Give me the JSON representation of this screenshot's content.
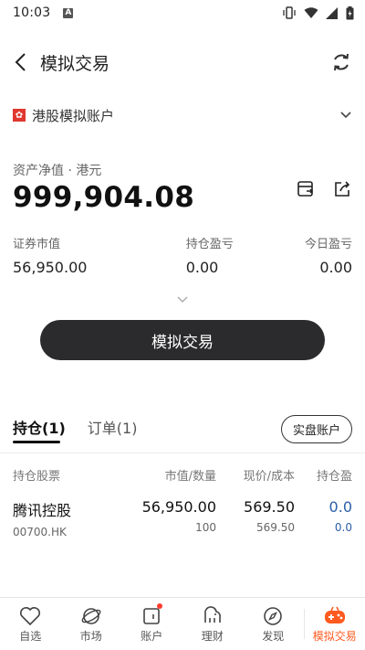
{
  "status_bar": {
    "time": "10:03",
    "badge": "A"
  },
  "nav": {
    "title": "模拟交易"
  },
  "account": {
    "name": "港股模拟账户",
    "flag": "✿"
  },
  "asset": {
    "label": "资产净值 · 港元",
    "value": "999,904.08"
  },
  "stats": [
    {
      "label": "证券市值",
      "value": "56,950.00"
    },
    {
      "label": "持仓盈亏",
      "value": "0.00"
    },
    {
      "label": "今日盈亏",
      "value": "0.00"
    }
  ],
  "trade_button": "模拟交易",
  "tabs": [
    {
      "label": "持仓(1)"
    },
    {
      "label": "订单(1)"
    }
  ],
  "real_account_button": "实盘账户",
  "table": {
    "headers": [
      "持仓股票",
      "市值/数量",
      "现价/成本",
      "持仓盈"
    ],
    "rows": [
      {
        "name": "腾讯控股",
        "code": "00700.HK",
        "market_value": "56,950.00",
        "quantity": "100",
        "price": "569.50",
        "cost": "569.50",
        "pnl": "0.0",
        "pnl_pct": "0.0"
      }
    ]
  },
  "bottom_nav": [
    {
      "label": "自选",
      "icon": "heart-icon"
    },
    {
      "label": "市场",
      "icon": "planet-icon"
    },
    {
      "label": "账户",
      "icon": "wallet-icon"
    },
    {
      "label": "理财",
      "icon": "elephant-icon"
    },
    {
      "label": "发现",
      "icon": "compass-icon"
    },
    {
      "label": "模拟交易",
      "icon": "gamepad-icon"
    }
  ],
  "colors": {
    "accent": "#ff5a1f",
    "button_dark": "#2b2b2d",
    "hk_flag": "#e0382e",
    "pnl_blue": "#2a5fa8"
  }
}
